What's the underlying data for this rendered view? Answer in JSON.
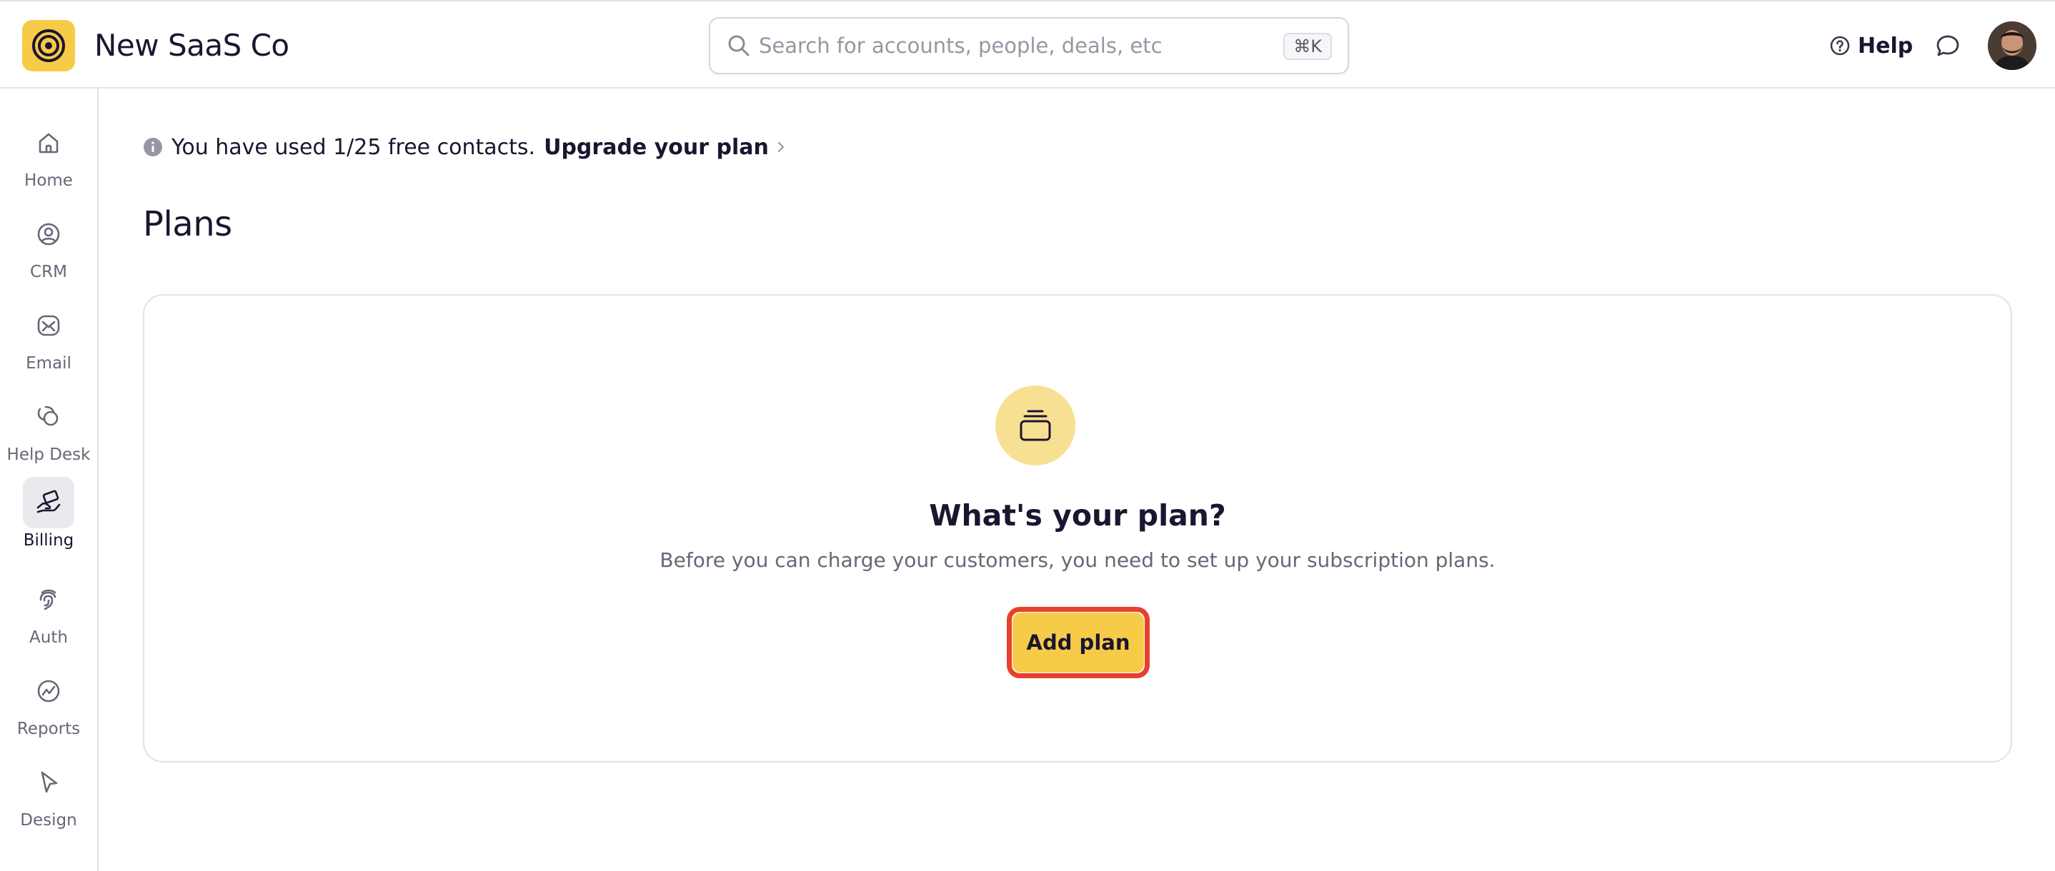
{
  "app": {
    "name": "New SaaS Co",
    "logo_icon": "concentric-circles-logo",
    "brand_color": "#f6cb47"
  },
  "search": {
    "placeholder": "Search for accounts, people, deals, etc",
    "shortcut": "⌘K"
  },
  "header": {
    "help_label": "Help",
    "help_icon": "question-circle-icon",
    "chat_icon": "chat-bubble-icon"
  },
  "sidebar": {
    "items": [
      {
        "label": "Home",
        "icon": "home-icon",
        "active": false
      },
      {
        "label": "CRM",
        "icon": "person-circle-icon",
        "active": false
      },
      {
        "label": "Email",
        "icon": "envelope-icon",
        "active": false
      },
      {
        "label": "Help Desk",
        "icon": "chat-bubbles-icon",
        "active": false
      },
      {
        "label": "Billing",
        "icon": "money-hand-icon",
        "active": true
      },
      {
        "label": "Auth",
        "icon": "fingerprint-icon",
        "active": false
      },
      {
        "label": "Reports",
        "icon": "chart-line-icon",
        "active": false
      },
      {
        "label": "Design",
        "icon": "cursor-arrow-icon",
        "active": false
      }
    ]
  },
  "notice": {
    "text": "You have used 1/25 free contacts.",
    "link": "Upgrade your plan"
  },
  "page": {
    "title": "Plans"
  },
  "empty_state": {
    "icon": "stacked-cards-icon",
    "title": "What's your plan?",
    "description": "Before you can charge your customers, you need to set up your subscription plans.",
    "button_label": "Add plan",
    "highlight_color": "#e8402c"
  }
}
